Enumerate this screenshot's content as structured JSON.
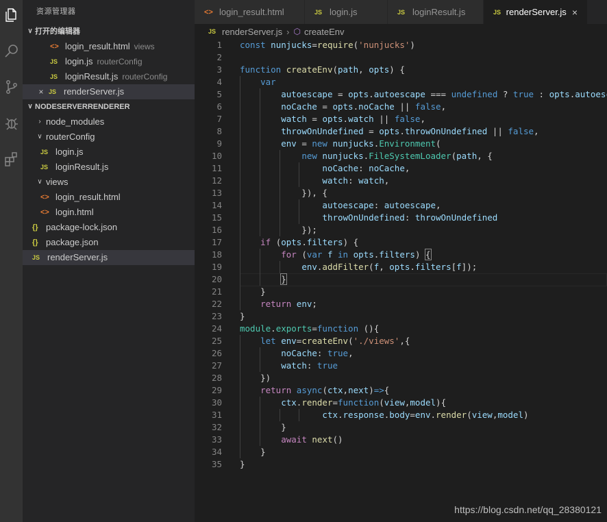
{
  "activity_bar": {
    "icons": [
      "files-icon",
      "search-icon",
      "source-control-icon",
      "debug-icon",
      "extensions-icon"
    ]
  },
  "sidebar": {
    "title": "资源管理器",
    "open_editors_label": "打开的编辑器",
    "open_editors": [
      {
        "name": "login_result.html",
        "hint": "views",
        "type": "html"
      },
      {
        "name": "login.js",
        "hint": "routerConfig",
        "type": "js"
      },
      {
        "name": "loginResult.js",
        "hint": "routerConfig",
        "type": "js"
      },
      {
        "name": "renderServer.js",
        "hint": "",
        "type": "js"
      }
    ],
    "project_label": "NODESERVERRENDERER",
    "tree": [
      {
        "name": "node_modules",
        "type": "folder-closed"
      },
      {
        "name": "routerConfig",
        "type": "folder-open"
      },
      {
        "name": "login.js",
        "type": "js"
      },
      {
        "name": "loginResult.js",
        "type": "js"
      },
      {
        "name": "views",
        "type": "folder-open"
      },
      {
        "name": "login_result.html",
        "type": "html"
      },
      {
        "name": "login.html",
        "type": "html"
      },
      {
        "name": "package-lock.json",
        "type": "json"
      },
      {
        "name": "package.json",
        "type": "json"
      },
      {
        "name": "renderServer.js",
        "type": "js"
      }
    ]
  },
  "tabs": [
    {
      "label": "login_result.html",
      "type": "html"
    },
    {
      "label": "login.js",
      "type": "js"
    },
    {
      "label": "loginResult.js",
      "type": "js"
    },
    {
      "label": "renderServer.js",
      "type": "js",
      "active": true
    }
  ],
  "icon_labels": {
    "js": "JS",
    "html": "<>",
    "json": "{}",
    "close": "×",
    "chevron_down": "∨",
    "chevron_right": "›"
  },
  "breadcrumb": {
    "file": "renderServer.js",
    "symbol": "createEnv"
  },
  "editor": {
    "lines": [
      [
        [
          "kw",
          "const"
        ],
        [
          "pn",
          " "
        ],
        [
          "vr",
          "nunjucks"
        ],
        [
          "pn",
          "="
        ],
        [
          "fn",
          "require"
        ],
        [
          "pn",
          "("
        ],
        [
          "st",
          "'nunjucks'"
        ],
        [
          "pn",
          ")"
        ]
      ],
      [],
      [
        [
          "kw",
          "function"
        ],
        [
          "pn",
          " "
        ],
        [
          "fn",
          "createEnv"
        ],
        [
          "pn",
          "("
        ],
        [
          "vr",
          "path"
        ],
        [
          "pn",
          ", "
        ],
        [
          "vr",
          "opts"
        ],
        [
          "pn",
          ") {"
        ]
      ],
      [
        [
          "pn",
          "    "
        ],
        [
          "kw",
          "var"
        ]
      ],
      [
        [
          "pn",
          "        "
        ],
        [
          "vr",
          "autoescape"
        ],
        [
          "pn",
          " = "
        ],
        [
          "vr",
          "opts"
        ],
        [
          "pn",
          "."
        ],
        [
          "vr",
          "autoescape"
        ],
        [
          "pn",
          " === "
        ],
        [
          "kw",
          "undefined"
        ],
        [
          "pn",
          " ? "
        ],
        [
          "kw",
          "true"
        ],
        [
          "pn",
          " : "
        ],
        [
          "vr",
          "opts"
        ],
        [
          "pn",
          "."
        ],
        [
          "vr",
          "autoescape"
        ]
      ],
      [
        [
          "pn",
          "        "
        ],
        [
          "vr",
          "noCache"
        ],
        [
          "pn",
          " = "
        ],
        [
          "vr",
          "opts"
        ],
        [
          "pn",
          "."
        ],
        [
          "vr",
          "noCache"
        ],
        [
          "pn",
          " || "
        ],
        [
          "kw",
          "false"
        ],
        [
          "pn",
          ","
        ]
      ],
      [
        [
          "pn",
          "        "
        ],
        [
          "vr",
          "watch"
        ],
        [
          "pn",
          " = "
        ],
        [
          "vr",
          "opts"
        ],
        [
          "pn",
          "."
        ],
        [
          "vr",
          "watch"
        ],
        [
          "pn",
          " || "
        ],
        [
          "kw",
          "false"
        ],
        [
          "pn",
          ","
        ]
      ],
      [
        [
          "pn",
          "        "
        ],
        [
          "vr",
          "throwOnUndefined"
        ],
        [
          "pn",
          " = "
        ],
        [
          "vr",
          "opts"
        ],
        [
          "pn",
          "."
        ],
        [
          "vr",
          "throwOnUndefined"
        ],
        [
          "pn",
          " || "
        ],
        [
          "kw",
          "false"
        ],
        [
          "pn",
          ","
        ]
      ],
      [
        [
          "pn",
          "        "
        ],
        [
          "vr",
          "env"
        ],
        [
          "pn",
          " = "
        ],
        [
          "kw",
          "new"
        ],
        [
          "pn",
          " "
        ],
        [
          "vr",
          "nunjucks"
        ],
        [
          "pn",
          "."
        ],
        [
          "ty",
          "Environment"
        ],
        [
          "pn",
          "("
        ]
      ],
      [
        [
          "pn",
          "            "
        ],
        [
          "kw",
          "new"
        ],
        [
          "pn",
          " "
        ],
        [
          "vr",
          "nunjucks"
        ],
        [
          "pn",
          "."
        ],
        [
          "ty",
          "FileSystemLoader"
        ],
        [
          "pn",
          "("
        ],
        [
          "vr",
          "path"
        ],
        [
          "pn",
          ", {"
        ]
      ],
      [
        [
          "pn",
          "                "
        ],
        [
          "vr",
          "noCache"
        ],
        [
          "pn",
          ": "
        ],
        [
          "vr",
          "noCache"
        ],
        [
          "pn",
          ","
        ]
      ],
      [
        [
          "pn",
          "                "
        ],
        [
          "vr",
          "watch"
        ],
        [
          "pn",
          ": "
        ],
        [
          "vr",
          "watch"
        ],
        [
          "pn",
          ","
        ]
      ],
      [
        [
          "pn",
          "            }), {"
        ]
      ],
      [
        [
          "pn",
          "                "
        ],
        [
          "vr",
          "autoescape"
        ],
        [
          "pn",
          ": "
        ],
        [
          "vr",
          "autoescape"
        ],
        [
          "pn",
          ","
        ]
      ],
      [
        [
          "pn",
          "                "
        ],
        [
          "vr",
          "throwOnUndefined"
        ],
        [
          "pn",
          ": "
        ],
        [
          "vr",
          "throwOnUndefined"
        ]
      ],
      [
        [
          "pn",
          "            });"
        ]
      ],
      [
        [
          "pn",
          "    "
        ],
        [
          "ctl",
          "if"
        ],
        [
          "pn",
          " ("
        ],
        [
          "vr",
          "opts"
        ],
        [
          "pn",
          "."
        ],
        [
          "vr",
          "filters"
        ],
        [
          "pn",
          ") {"
        ]
      ],
      [
        [
          "pn",
          "        "
        ],
        [
          "ctl",
          "for"
        ],
        [
          "pn",
          " ("
        ],
        [
          "kw",
          "var"
        ],
        [
          "pn",
          " "
        ],
        [
          "vr",
          "f"
        ],
        [
          "pn",
          " "
        ],
        [
          "kw",
          "in"
        ],
        [
          "pn",
          " "
        ],
        [
          "vr",
          "opts"
        ],
        [
          "pn",
          "."
        ],
        [
          "vr",
          "filters"
        ],
        [
          "pn",
          ") "
        ],
        [
          "br",
          "{"
        ]
      ],
      [
        [
          "pn",
          "            "
        ],
        [
          "vr",
          "env"
        ],
        [
          "pn",
          "."
        ],
        [
          "fn",
          "addFilter"
        ],
        [
          "pn",
          "("
        ],
        [
          "vr",
          "f"
        ],
        [
          "pn",
          ", "
        ],
        [
          "vr",
          "opts"
        ],
        [
          "pn",
          "."
        ],
        [
          "vr",
          "filters"
        ],
        [
          "pn",
          "["
        ],
        [
          "vr",
          "f"
        ],
        [
          "pn",
          "]);"
        ]
      ],
      [
        [
          "pn",
          "        "
        ],
        [
          "br",
          "}"
        ]
      ],
      [
        [
          "pn",
          "    }"
        ]
      ],
      [
        [
          "pn",
          "    "
        ],
        [
          "ctl",
          "return"
        ],
        [
          "pn",
          " "
        ],
        [
          "vr",
          "env"
        ],
        [
          "pn",
          ";"
        ]
      ],
      [
        [
          "pn",
          "}"
        ]
      ],
      [
        [
          "ty",
          "module"
        ],
        [
          "pn",
          "."
        ],
        [
          "ty",
          "exports"
        ],
        [
          "pn",
          "="
        ],
        [
          "kw",
          "function"
        ],
        [
          "pn",
          " (){"
        ]
      ],
      [
        [
          "pn",
          "    "
        ],
        [
          "kw",
          "let"
        ],
        [
          "pn",
          " "
        ],
        [
          "vr",
          "env"
        ],
        [
          "pn",
          "="
        ],
        [
          "fn",
          "createEnv"
        ],
        [
          "pn",
          "("
        ],
        [
          "st",
          "'./views'"
        ],
        [
          "pn",
          ",{"
        ]
      ],
      [
        [
          "pn",
          "        "
        ],
        [
          "vr",
          "noCache"
        ],
        [
          "pn",
          ": "
        ],
        [
          "kw",
          "true"
        ],
        [
          "pn",
          ","
        ]
      ],
      [
        [
          "pn",
          "        "
        ],
        [
          "vr",
          "watch"
        ],
        [
          "pn",
          ": "
        ],
        [
          "kw",
          "true"
        ]
      ],
      [
        [
          "pn",
          "    })"
        ]
      ],
      [
        [
          "pn",
          "    "
        ],
        [
          "ctl",
          "return"
        ],
        [
          "pn",
          " "
        ],
        [
          "kw",
          "async"
        ],
        [
          "pn",
          "("
        ],
        [
          "vr",
          "ctx"
        ],
        [
          "pn",
          ","
        ],
        [
          "vr",
          "next"
        ],
        [
          "pn",
          ")"
        ],
        [
          "kw",
          "=>"
        ],
        [
          "pn",
          "{"
        ]
      ],
      [
        [
          "pn",
          "        "
        ],
        [
          "vr",
          "ctx"
        ],
        [
          "pn",
          "."
        ],
        [
          "fn",
          "render"
        ],
        [
          "pn",
          "="
        ],
        [
          "kw",
          "function"
        ],
        [
          "pn",
          "("
        ],
        [
          "vr",
          "view"
        ],
        [
          "pn",
          ","
        ],
        [
          "vr",
          "model"
        ],
        [
          "pn",
          "){"
        ]
      ],
      [
        [
          "pn",
          "                "
        ],
        [
          "vr",
          "ctx"
        ],
        [
          "pn",
          "."
        ],
        [
          "vr",
          "response"
        ],
        [
          "pn",
          "."
        ],
        [
          "vr",
          "body"
        ],
        [
          "pn",
          "="
        ],
        [
          "vr",
          "env"
        ],
        [
          "pn",
          "."
        ],
        [
          "fn",
          "render"
        ],
        [
          "pn",
          "("
        ],
        [
          "vr",
          "view"
        ],
        [
          "pn",
          ","
        ],
        [
          "vr",
          "model"
        ],
        [
          "pn",
          ")"
        ]
      ],
      [
        [
          "pn",
          "        }"
        ]
      ],
      [
        [
          "pn",
          "        "
        ],
        [
          "ctl",
          "await"
        ],
        [
          "pn",
          " "
        ],
        [
          "fn",
          "next"
        ],
        [
          "pn",
          "()"
        ]
      ],
      [
        [
          "pn",
          "    }"
        ]
      ],
      [
        [
          "pn",
          "}"
        ]
      ]
    ],
    "cursor_line": 20
  },
  "watermark": "https://blog.csdn.net/qq_28380121"
}
